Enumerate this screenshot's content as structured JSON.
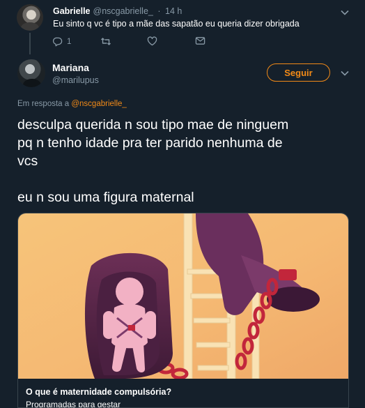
{
  "reply_tweet": {
    "author_name": "Gabrielle",
    "author_handle": "@nscgabrielle_",
    "separator": "·",
    "time": "14 h",
    "text": "Eu sinto q vc é tipo a mãe das sapatão eu queria dizer obrigada",
    "reply_count": "1",
    "icons": [
      "reply-icon",
      "retweet-icon",
      "like-icon",
      "direct-message-icon"
    ]
  },
  "main_tweet": {
    "author_name": "Mariana",
    "author_handle": "@marilupus",
    "follow_label": "Seguir",
    "replying_prefix": "Em resposta a",
    "replying_handle": "@nscgabrielle_",
    "text_lines": [
      "desculpa querida n sou tipo mae de ninguem",
      "pq n tenho idade pra ter parido nenhuma de",
      "vcs"
    ],
    "text_second_paragraph": "eu n sou uma figura maternal"
  },
  "link_card": {
    "title": "O que é maternidade compulsória?",
    "description": "Programadas para gestar"
  },
  "colors": {
    "background": "#15202b",
    "accent": "#f28a17",
    "secondary_text": "#8899a6",
    "border": "#38444d"
  }
}
